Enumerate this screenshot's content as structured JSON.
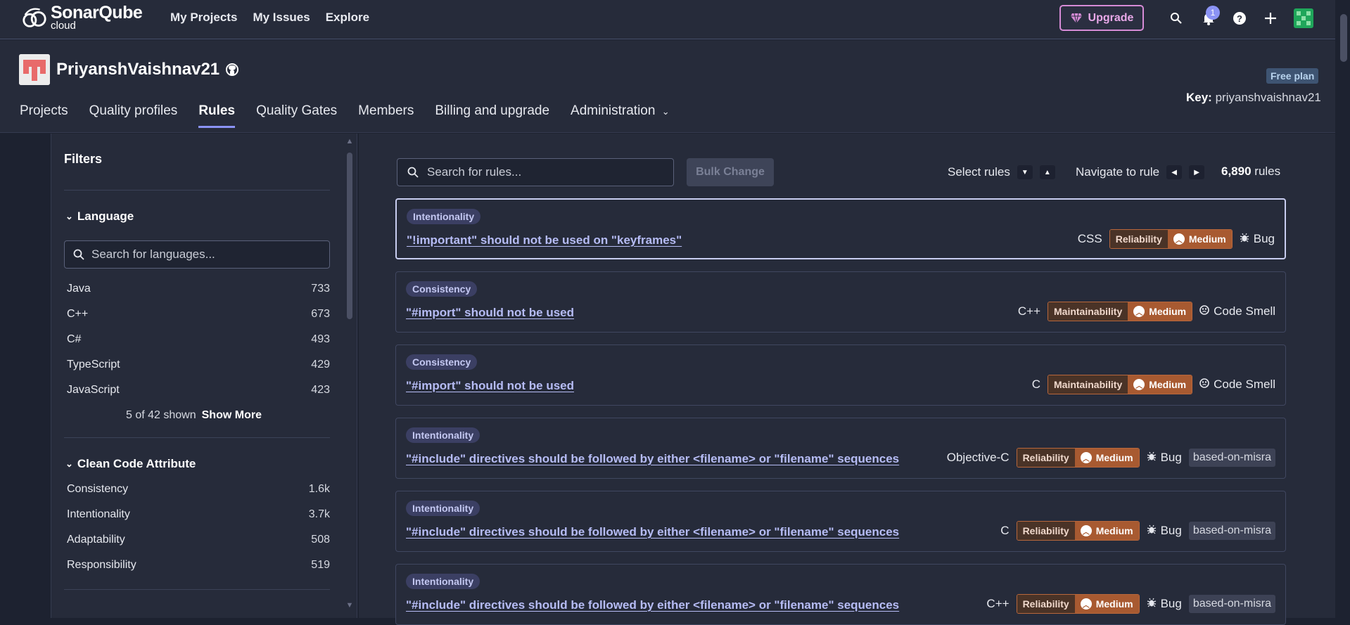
{
  "app": {
    "logo_line1": "SonarQube",
    "logo_line2": "cloud"
  },
  "topnav": [
    "My Projects",
    "My Issues",
    "Explore"
  ],
  "upgrade_label": "Upgrade",
  "notifications_count": "1",
  "org": {
    "name": "PriyanshVaishnav21",
    "plan": "Free plan",
    "key_label": "Key:",
    "key_value": "priyanshvaishnav21"
  },
  "tabs": [
    "Projects",
    "Quality profiles",
    "Rules",
    "Quality Gates",
    "Members",
    "Billing and upgrade",
    "Administration"
  ],
  "active_tab": "Rules",
  "filters": {
    "title": "Filters",
    "language": {
      "title": "Language",
      "search_placeholder": "Search for languages...",
      "items": [
        {
          "label": "Java",
          "count": "733"
        },
        {
          "label": "C++",
          "count": "673"
        },
        {
          "label": "C#",
          "count": "493"
        },
        {
          "label": "TypeScript",
          "count": "429"
        },
        {
          "label": "JavaScript",
          "count": "423"
        }
      ],
      "shown_text": "5 of 42 shown",
      "show_more": "Show More"
    },
    "clean_code": {
      "title": "Clean Code Attribute",
      "items": [
        {
          "label": "Consistency",
          "count": "1.6k"
        },
        {
          "label": "Intentionality",
          "count": "3.7k"
        },
        {
          "label": "Adaptability",
          "count": "508"
        },
        {
          "label": "Responsibility",
          "count": "519"
        }
      ]
    }
  },
  "toolbar": {
    "search_placeholder": "Search for rules...",
    "bulk_change": "Bulk Change",
    "select_rules": "Select rules",
    "navigate": "Navigate to rule",
    "count": "6,890",
    "count_suffix": "rules"
  },
  "rules": [
    {
      "attribute": "Intentionality",
      "title": "\"!important\" should not be used on \"keyframes\"",
      "language": "CSS",
      "quality": "Reliability",
      "severity": "Medium",
      "type": "Bug",
      "tag": ""
    },
    {
      "attribute": "Consistency",
      "title": "\"#import\" should not be used",
      "language": "C++",
      "quality": "Maintainability",
      "severity": "Medium",
      "type": "Code Smell",
      "tag": ""
    },
    {
      "attribute": "Consistency",
      "title": "\"#import\" should not be used",
      "language": "C",
      "quality": "Maintainability",
      "severity": "Medium",
      "type": "Code Smell",
      "tag": ""
    },
    {
      "attribute": "Intentionality",
      "title": "\"#include\" directives should be followed by either <filename> or \"filename\" sequences",
      "language": "Objective-C",
      "quality": "Reliability",
      "severity": "Medium",
      "type": "Bug",
      "tag": "based-on-misra"
    },
    {
      "attribute": "Intentionality",
      "title": "\"#include\" directives should be followed by either <filename> or \"filename\" sequences",
      "language": "C",
      "quality": "Reliability",
      "severity": "Medium",
      "type": "Bug",
      "tag": "based-on-misra"
    },
    {
      "attribute": "Intentionality",
      "title": "\"#include\" directives should be followed by either <filename> or \"filename\" sequences",
      "language": "C++",
      "quality": "Reliability",
      "severity": "Medium",
      "type": "Bug",
      "tag": "based-on-misra"
    }
  ]
}
